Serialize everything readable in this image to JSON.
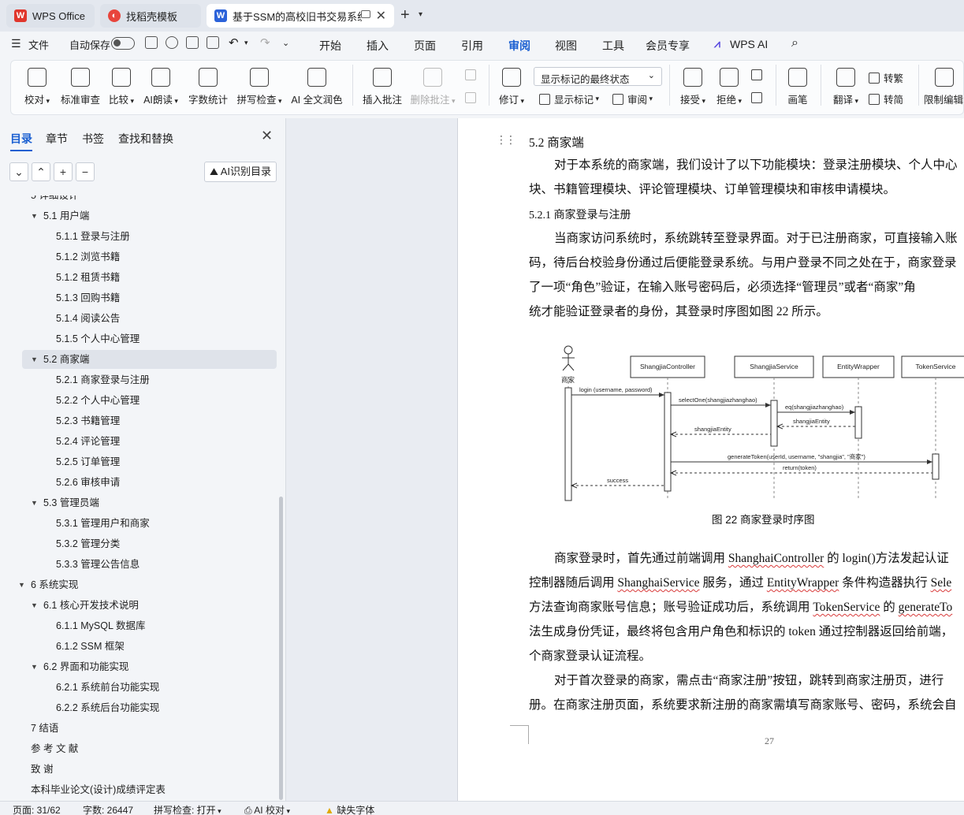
{
  "tabs": {
    "wps": "WPS Office",
    "template": "找稻壳模板",
    "document": "基于SSM的高校旧书交易系统"
  },
  "menu": {
    "file": "文件",
    "autosave": "自动保存",
    "items": [
      "开始",
      "插入",
      "页面",
      "引用",
      "审阅",
      "视图",
      "工具",
      "会员专享"
    ],
    "active": "审阅",
    "wps_ai": "WPS AI"
  },
  "ribbon": {
    "proofread": "校对",
    "standard_review": "标准审查",
    "compare": "比较",
    "ai_read": "AI朗读",
    "word_count": "字数统计",
    "spell_check": "拼写检查",
    "ai_polish": "AI 全文润色",
    "insert_comment": "插入批注",
    "delete_comment": "删除批注",
    "track": "修订",
    "display_dropdown": "显示标记的最终状态",
    "show_markup": "显示标记",
    "review": "审阅",
    "accept": "接受",
    "reject": "拒绝",
    "pen": "画笔",
    "translate": "翻译",
    "to_traditional": "转繁",
    "to_simplified": "转简",
    "restrict_edit": "限制编辑"
  },
  "nav_pane": {
    "tabs": [
      "目录",
      "章节",
      "书签",
      "查找和替换"
    ],
    "active_tab": "目录",
    "ai_button": "AI识别目录",
    "toc": [
      {
        "label": "5  详细设计",
        "level": 1,
        "expanded": true
      },
      {
        "label": "5.1  用户端",
        "level": 2,
        "expanded": true
      },
      {
        "label": "5.1.1  登录与注册",
        "level": 3
      },
      {
        "label": "5.1.2  浏览书籍",
        "level": 3
      },
      {
        "label": "5.1.2  租赁书籍",
        "level": 3
      },
      {
        "label": "5.1.3  回购书籍",
        "level": 3
      },
      {
        "label": "5.1.4  阅读公告",
        "level": 3
      },
      {
        "label": "5.1.5  个人中心管理",
        "level": 3
      },
      {
        "label": "5.2  商家端",
        "level": 2,
        "expanded": true,
        "selected": true
      },
      {
        "label": "5.2.1  商家登录与注册",
        "level": 3
      },
      {
        "label": "5.2.2  个人中心管理",
        "level": 3
      },
      {
        "label": "5.2.3  书籍管理",
        "level": 3
      },
      {
        "label": "5.2.4  评论管理",
        "level": 3
      },
      {
        "label": "5.2.5  订单管理",
        "level": 3
      },
      {
        "label": "5.2.6  审核申请",
        "level": 3
      },
      {
        "label": "5.3  管理员端",
        "level": 2,
        "expanded": true
      },
      {
        "label": "5.3.1  管理用户和商家",
        "level": 3
      },
      {
        "label": "5.3.2  管理分类",
        "level": 3
      },
      {
        "label": "5.3.3  管理公告信息",
        "level": 3
      },
      {
        "label": "6  系统实现",
        "level": 1,
        "expanded": true
      },
      {
        "label": "6.1  核心开发技术说明",
        "level": 2,
        "expanded": true
      },
      {
        "label": "6.1.1 MySQL 数据库",
        "level": 3
      },
      {
        "label": "6.1.2 SSM 框架",
        "level": 3
      },
      {
        "label": "6.2  界面和功能实现",
        "level": 2,
        "expanded": true
      },
      {
        "label": "6.2.1  系统前台功能实现",
        "level": 3
      },
      {
        "label": "6.2.2  系统后台功能实现",
        "level": 3
      },
      {
        "label": "7  结语",
        "level": 1
      },
      {
        "label": "参 考 文 献",
        "level": 1
      },
      {
        "label": "致     谢",
        "level": 1
      },
      {
        "label": "本科毕业论文(设计)成绩评定表",
        "level": 1
      }
    ]
  },
  "document": {
    "heading": "5.2  商家端",
    "para1": [
      "对于本系统的商家端，我们设计了以下功能模块：登录注册模块、个人中心",
      "块、书籍管理模块、评论管理模块、订单管理模块和审核申请模块。"
    ],
    "subheading": "5.2.1  商家登录与注册",
    "para2": [
      "当商家访问系统时，系统跳转至登录界面。对于已注册商家，可直接输入账",
      "码，待后台校验身份通过后便能登录系统。与用户登录不同之处在于，商家登录",
      "了一项“角色”验证，在输入账号密码后，必须选择“管理员”或者“商家”角",
      "统才能验证登录者的身份，其登录时序图如图 22 所示。"
    ],
    "caption": "图 22  商家登录时序图",
    "para3": {
      "l1a": "商家登录时，首先通过前端调用 ",
      "l1b": "ShanghaiController",
      "l1c": " 的 login()方法发起认证",
      "l2a": "控制器随后调用 ",
      "l2b": "ShanghaiService",
      "l2c": " 服务，通过 ",
      "l2d": "EntityWrapper",
      "l2e": " 条件构造器执行 ",
      "l2f": "Sele",
      "l3a": "方法查询商家账号信息；账号验证成功后，系统调用 ",
      "l3b": "TokenService",
      "l3c": " 的 ",
      "l3d": "generateTo",
      "l4": "法生成身份凭证，最终将包含用户角色和标识的 token 通过控制器返回给前端，",
      "l5": "个商家登录认证流程。"
    },
    "para4": [
      "对于首次登录的商家，需点击“商家注册”按钮，跳转到商家注册页，进行",
      "册。在商家注册页面，系统要求新注册的商家需填写商家账号、密码，系统会自"
    ],
    "page_number": "27",
    "diagram": {
      "actor": "商家",
      "lifelines": [
        "ShangjiaController",
        "ShangjiaService",
        "EntityWrapper",
        "TokenService"
      ],
      "messages": [
        "login (username, password)",
        "selectOne(shangjiazhanghao)",
        "eq(shangjiazhanghao)",
        "shangjiaEntity",
        "shangjiaEntity",
        "generateToken(userId, username, \"shangjia\", \"商家\")",
        "return(token)",
        "success"
      ]
    }
  },
  "status": {
    "page": "页面: 31/62",
    "words": "字数: 26447",
    "spell": "拼写检查: 打开",
    "ai": "AI 校对",
    "font": "缺失字体"
  }
}
